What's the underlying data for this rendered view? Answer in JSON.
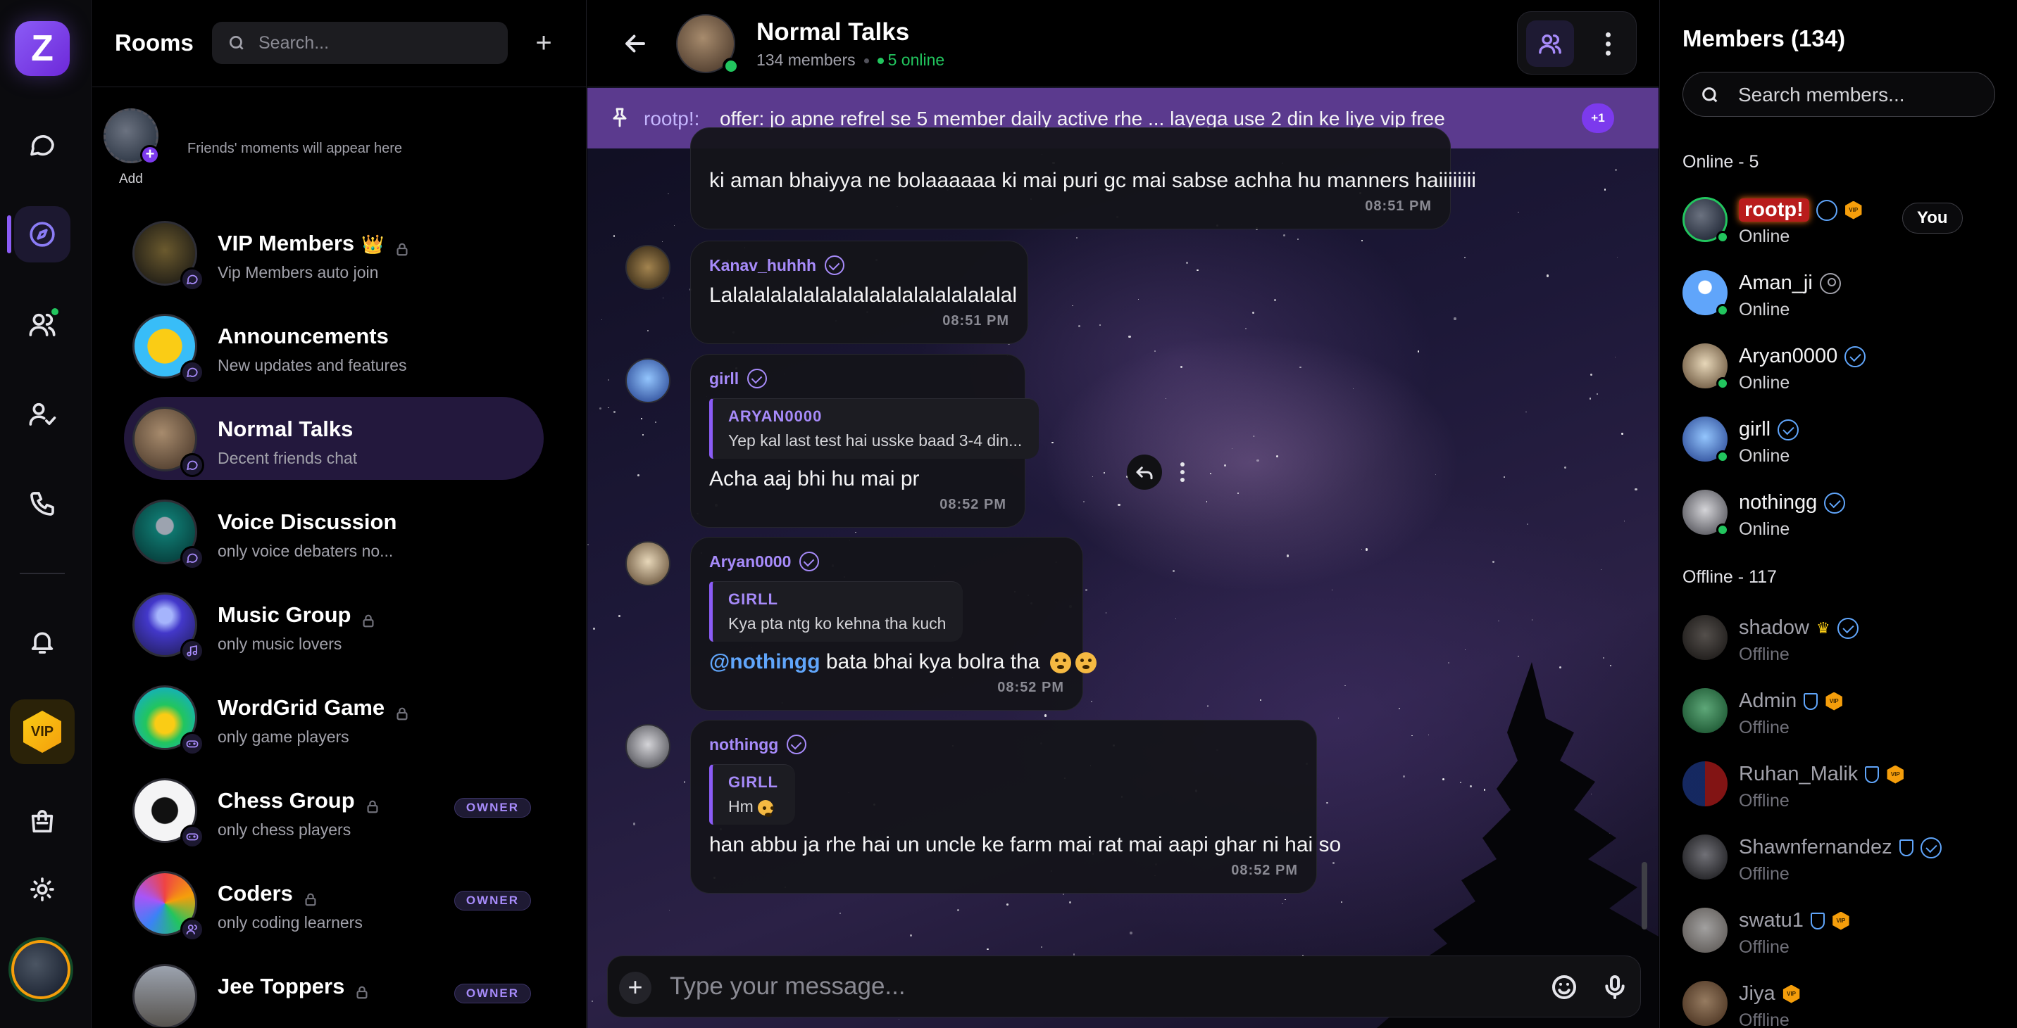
{
  "rail": {
    "logo_letter": "Z",
    "vip_label": "VIP",
    "items": [
      "chat-icon",
      "compass-icon",
      "friends-icon",
      "user-check-icon",
      "phone-icon",
      "bell-icon",
      "vip-icon",
      "bag-icon",
      "sun-icon"
    ]
  },
  "rooms": {
    "title": "Rooms",
    "search_placeholder": "Search...",
    "add": "+",
    "moments": {
      "add_label": "Add",
      "note": "Friends' moments will appear here"
    },
    "list": [
      {
        "name": "VIP Members",
        "sub": "Vip Members auto join",
        "locked": true,
        "crown": "👑",
        "badge": "chat-icon",
        "owner": ""
      },
      {
        "name": "Announcements",
        "sub": "New updates and features",
        "locked": false,
        "badge": "chat-icon",
        "owner": ""
      },
      {
        "name": "Normal Talks",
        "sub": "Decent friends chat",
        "locked": false,
        "badge": "chat-icon",
        "owner": "",
        "active": true
      },
      {
        "name": "Voice Discussion",
        "sub": "only voice debaters no...",
        "locked": false,
        "badge": "chat-icon",
        "owner": ""
      },
      {
        "name": "Music Group",
        "sub": "only music lovers",
        "locked": true,
        "badge": "music-icon",
        "owner": ""
      },
      {
        "name": "WordGrid Game",
        "sub": "only game players",
        "locked": true,
        "badge": "gamepad-icon",
        "owner": ""
      },
      {
        "name": "Chess Group",
        "sub": "only chess players",
        "locked": true,
        "badge": "gamepad-icon",
        "owner": "OWNER"
      },
      {
        "name": "Coders",
        "sub": "only coding learners",
        "locked": true,
        "badge": "users-icon",
        "owner": "OWNER"
      },
      {
        "name": "Jee Toppers",
        "sub": "",
        "locked": true,
        "badge": "",
        "owner": "OWNER"
      }
    ]
  },
  "chat": {
    "name": "Normal Talks",
    "members_count": "134 members",
    "online": "5 online",
    "pinned": {
      "author": "rootp!:",
      "text": "offer: jo apne refrel se 5 member daily active rhe ... layega use 2 din ke liye vip free",
      "more": "+1"
    },
    "messages": [
      {
        "author": "",
        "body": "ki aman bhaiyya ne bolaaaaaa ki mai puri gc mai sabse achha hu manners haiiiiiiii",
        "time": "08:51 PM"
      },
      {
        "author": "Kanav_huhhh",
        "body": "Lalalalalalalalalalalalalalalalalalal",
        "time": "08:51 PM"
      },
      {
        "author": "girll",
        "quote_author": "ARYAN0000",
        "quote_text": "Yep kal last test hai usske baad 3-4 din...",
        "body": "Acha aaj bhi hu mai pr",
        "time": "08:52 PM"
      },
      {
        "author": "Aryan0000",
        "quote_author": "GIRLL",
        "quote_text": "Kya pta ntg ko kehna tha kuch",
        "mention": "@nothingg",
        "body": "bata bhai kya bolra tha",
        "time": "08:52 PM"
      },
      {
        "author": "nothingg",
        "quote_author": "GIRLL",
        "quote_text": "Hm",
        "body": "han abbu ja rhe hai un uncle ke farm mai rat mai aapi ghar ni hai so",
        "time": "08:52 PM"
      }
    ],
    "composer_placeholder": "Type your message..."
  },
  "members": {
    "title": "Members (134)",
    "search_placeholder": "Search members...",
    "online_title": "Online - 5",
    "offline_title": "Offline - 117",
    "you_label": "You",
    "online": [
      {
        "name": "rootp!",
        "status": "Online"
      },
      {
        "name": "Aman_ji",
        "status": "Online"
      },
      {
        "name": "Aryan0000",
        "status": "Online"
      },
      {
        "name": "girll",
        "status": "Online"
      },
      {
        "name": "nothingg",
        "status": "Online"
      }
    ],
    "offline": [
      {
        "name": "shadow",
        "status": "Offline"
      },
      {
        "name": "Admin",
        "status": "Offline"
      },
      {
        "name": "Ruhan_Malik",
        "status": "Offline"
      },
      {
        "name": "Shawnfernandez",
        "status": "Offline"
      },
      {
        "name": "swatu1",
        "status": "Offline"
      },
      {
        "name": "Jiya",
        "status": "Offline"
      }
    ]
  },
  "colors": {
    "accent": "#8b5cf6",
    "online": "#22c55e",
    "pinned_bg": "#5b3a8e",
    "owner_text": "#a78bfa"
  }
}
